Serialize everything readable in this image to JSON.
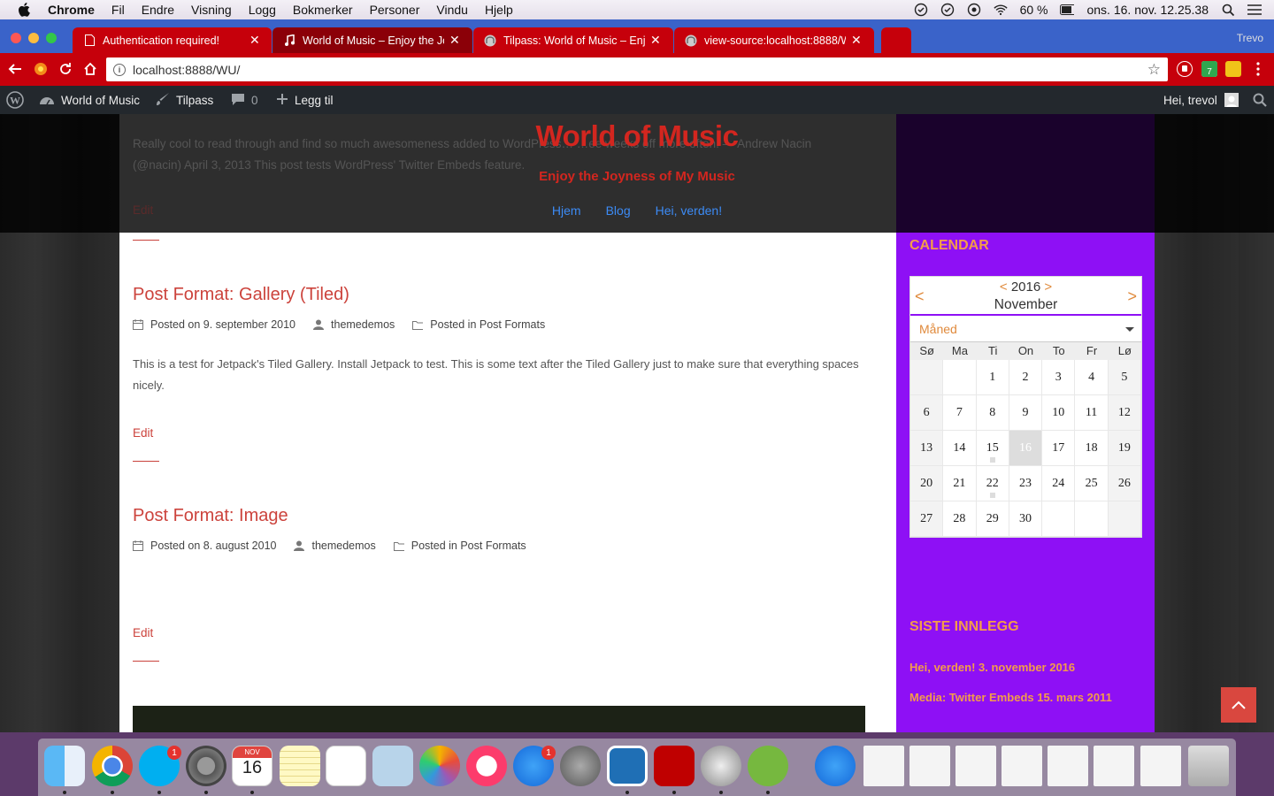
{
  "menubar": {
    "app": "Chrome",
    "items": [
      "Fil",
      "Endre",
      "Visning",
      "Logg",
      "Bokmerker",
      "Personer",
      "Vindu",
      "Hjelp"
    ],
    "battery": "60 %",
    "clock": "ons. 16. nov.  12.25.38"
  },
  "tabs": [
    {
      "title": "Authentication required!",
      "active": false
    },
    {
      "title": "World of Music – Enjoy the Joy",
      "active": true
    },
    {
      "title": "Tilpass: World of Music – Enjoy",
      "active": false
    },
    {
      "title": "view-source:localhost:8888/W",
      "active": false
    }
  ],
  "profile_name": "Trevo",
  "address": {
    "url": "localhost:8888/WU/"
  },
  "adminbar": {
    "site": "World of Music",
    "customize": "Tilpass",
    "comments": "0",
    "new": "Legg til",
    "greeting": "Hei, trevol"
  },
  "site": {
    "title": "World of Music",
    "tagline": "Enjoy the Joyness of My Music",
    "nav": [
      "Hjem",
      "Blog",
      "Hei, verden!"
    ],
    "ghost_text": "Really cool to read through and find so much awesomeness added to WordPress… …ee weeks off more often. — Andrew Nacin (@nacin) April 3, 2013 This post tests WordPress' Twitter Embeds feature.",
    "ghost_edit": "Edit"
  },
  "posts": [
    {
      "title": "Post Format: Gallery (Tiled)",
      "date": "Posted on 9. september 2010",
      "author": "themedemos",
      "category": "Posted in Post Formats",
      "excerpt": "This is a test for Jetpack's Tiled Gallery. Install Jetpack to test. This is some text after the Tiled Gallery just to make sure that everything spaces nicely.",
      "edit": "Edit"
    },
    {
      "title": "Post Format: Image",
      "date": "Posted on 8. august 2010",
      "author": "themedemos",
      "category": "Posted in Post Formats",
      "excerpt": "",
      "edit": "Edit"
    }
  ],
  "calendar": {
    "widget_title": "CALENDAR",
    "year": "2016",
    "month": "November",
    "view": "Måned",
    "prev": "<",
    "next": ">",
    "weekdays": [
      "Sø",
      "Ma",
      "Ti",
      "On",
      "To",
      "Fr",
      "Lø"
    ],
    "today": "16",
    "days": [
      "",
      "",
      "1",
      "2",
      "3",
      "4",
      "5",
      "6",
      "7",
      "8",
      "9",
      "10",
      "11",
      "12",
      "13",
      "14",
      "15",
      "16",
      "17",
      "18",
      "19",
      "20",
      "21",
      "22",
      "23",
      "24",
      "25",
      "26",
      "27",
      "28",
      "29",
      "30",
      "",
      "",
      ""
    ]
  },
  "recent": {
    "widget_title": "SISTE INNLEGG",
    "items": [
      "Hei, verden! 3. november 2016",
      "Media: Twitter Embeds 15. mars 2011"
    ]
  },
  "dock": {
    "calendar_month": "NOV",
    "calendar_day": "16",
    "badges": {
      "skype": "1",
      "appstore": "1"
    }
  },
  "colors": {
    "accent_red": "#cc433c",
    "sidebar_purple": "#8e10f5",
    "widget_orange": "#f39c4a",
    "nav_blue": "#3c8bf5",
    "tabbar_blue": "#3a63c9",
    "toolbar_red": "#c6000b"
  }
}
